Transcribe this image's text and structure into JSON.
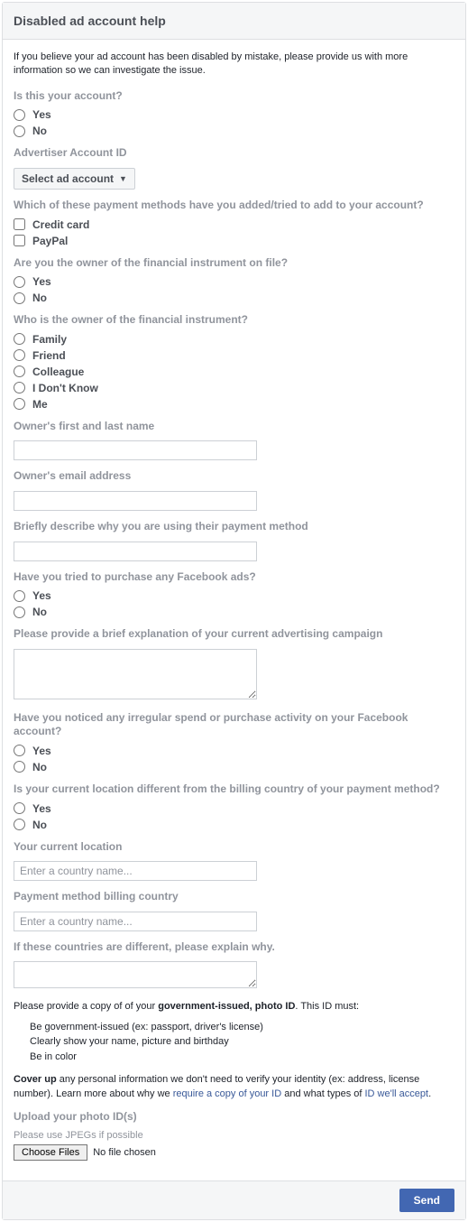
{
  "header": {
    "title": "Disabled ad account help"
  },
  "intro": "If you believe your ad account has been disabled by mistake, please provide us with more information so we can investigate the issue.",
  "q_is_this_your_account": {
    "label": "Is this your account?",
    "options": {
      "yes": "Yes",
      "no": "No"
    }
  },
  "q_advertiser_account_id": {
    "label": "Advertiser Account ID",
    "dropdown_label": "Select ad account"
  },
  "q_payment_methods": {
    "label": "Which of these payment methods have you added/tried to add to your account?",
    "options": {
      "credit_card": "Credit card",
      "paypal": "PayPal"
    }
  },
  "q_owner_of_fi": {
    "label": "Are you the owner of the financial instrument on file?",
    "options": {
      "yes": "Yes",
      "no": "No"
    }
  },
  "q_who_owner": {
    "label": "Who is the owner of the financial instrument?",
    "options": {
      "family": "Family",
      "friend": "Friend",
      "colleague": "Colleague",
      "dont_know": "I Don't Know",
      "me": "Me"
    }
  },
  "q_owner_name": {
    "label": "Owner's first and last name"
  },
  "q_owner_email": {
    "label": "Owner's email address"
  },
  "q_brief_why": {
    "label": "Briefly describe why you are using their payment method"
  },
  "q_tried_purchase": {
    "label": "Have you tried to purchase any Facebook ads?",
    "options": {
      "yes": "Yes",
      "no": "No"
    }
  },
  "q_brief_campaign": {
    "label": "Please provide a brief explanation of your current advertising campaign"
  },
  "q_irregular_spend": {
    "label": "Have you noticed any irregular spend or purchase activity on your Facebook account?",
    "options": {
      "yes": "Yes",
      "no": "No"
    }
  },
  "q_location_diff": {
    "label": "Is your current location different from the billing country of your payment method?",
    "options": {
      "yes": "Yes",
      "no": "No"
    }
  },
  "q_current_location": {
    "label": "Your current location",
    "placeholder": "Enter a country name..."
  },
  "q_billing_country": {
    "label": "Payment method billing country",
    "placeholder": "Enter a country name..."
  },
  "q_countries_diff": {
    "label": "If these countries are different, please explain why."
  },
  "id_section": {
    "intro_pre": "Please provide a copy of of your ",
    "intro_bold": "government-issued, photo ID",
    "intro_post": ". This ID must:",
    "bullets": {
      "b1": "Be government-issued (ex: passport, driver's license)",
      "b2": "Clearly show your name, picture and birthday",
      "b3": "Be in color"
    },
    "coverup_pre_bold": "Cover up",
    "coverup_text1": " any personal information we don't need to verify your identity (ex: address, license number). Learn more about why we ",
    "coverup_link1": "require a copy of your ID",
    "coverup_text2": " and what types of ",
    "coverup_link2": "ID we'll accept",
    "coverup_text3": "."
  },
  "q_upload": {
    "label": "Upload your photo ID(s)",
    "hint": "Please use JPEGs if possible",
    "button": "Choose Files",
    "status": "No file chosen"
  },
  "footer": {
    "send": "Send"
  }
}
